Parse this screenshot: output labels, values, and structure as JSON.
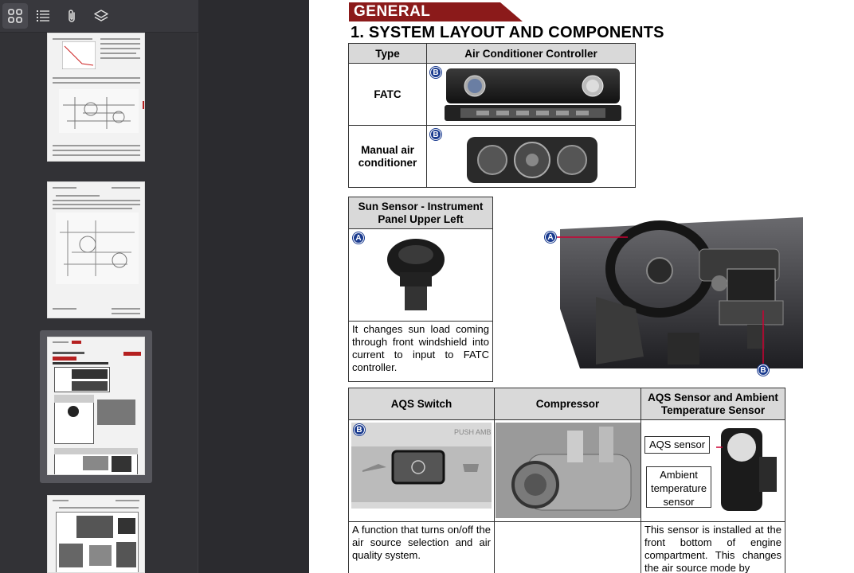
{
  "toolbar": {
    "buttons": [
      {
        "icon": "grid-view-icon",
        "active": true
      },
      {
        "icon": "outline-list-icon",
        "active": false
      },
      {
        "icon": "attachment-icon",
        "active": false
      },
      {
        "icon": "layers-icon",
        "active": false
      }
    ]
  },
  "page": {
    "banner": "GENERAL",
    "title": "1. SYSTEM LAYOUT AND COMPONENTS",
    "controller_table": {
      "headers": [
        "Type",
        "Air Conditioner Controller"
      ],
      "rows": [
        {
          "type": "FATC",
          "badge": "B"
        },
        {
          "type": "Manual air conditioner",
          "badge": "B"
        }
      ]
    },
    "sun_sensor": {
      "header": "Sun Sensor - Instrument Panel Upper Left",
      "badge": "A",
      "description": "It changes sun load coming through front windshield into current to input to FATC controller."
    },
    "dashboard_photo": {
      "badge_top": "A",
      "badge_bottom": "B"
    },
    "bottom_table": {
      "headers": [
        "AQS Switch",
        "Compressor",
        "AQS Sensor and Ambient Temperature Sensor"
      ],
      "aqs_badge": "B",
      "aqs_push_label": "PUSH AMB",
      "aqs_description": "A function that turns on/off the air source selection and air quality system.",
      "sensor_callouts": [
        "AQS sensor",
        "Ambient temperature sensor"
      ],
      "sensor_description": "This sensor is installed at the front bottom of engine compartment. This changes the air source mode by"
    }
  },
  "colors": {
    "banner": "#8b1a1a",
    "badge": "#1a3b8f",
    "header_fill": "#d9d9d9",
    "sidebar": "#323236"
  }
}
